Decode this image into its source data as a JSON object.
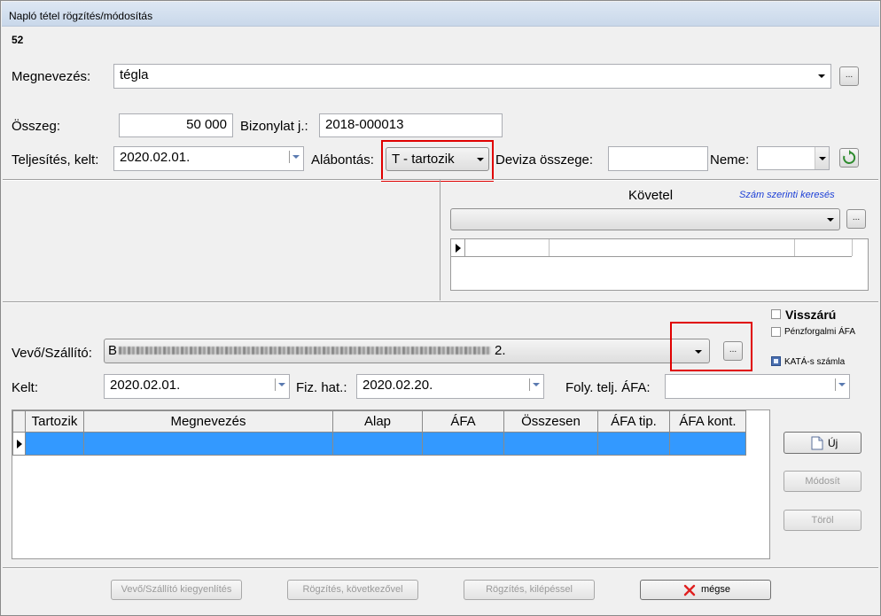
{
  "window": {
    "title": "Napló tétel rögzítés/módosítás"
  },
  "record_id": "52",
  "megnevezes": {
    "label": "Megnevezés:",
    "value": "tégla"
  },
  "osszeg": {
    "label": "Összeg:",
    "value": "50 000"
  },
  "bizonylat": {
    "label": "Bizonylat j.:",
    "value": "2018-000013"
  },
  "teljesites": {
    "label": "Teljesítés, kelt:",
    "value": "2020.02.01."
  },
  "alabontas": {
    "label": "Alábontás:",
    "value": "T - tartozik"
  },
  "deviza": {
    "label": "Deviza összege:",
    "value": ""
  },
  "neme": {
    "label": "Neme:",
    "value": ""
  },
  "kovetel": {
    "label": "Követel",
    "search_link": "Szám szerinti keresés",
    "value": ""
  },
  "vevo": {
    "visszaru_label": "Visszárú",
    "penzforgalmi_label": "Pénzforgalmi ÁFA",
    "kata_label": "KATÁ-s számla",
    "kata_checked": true,
    "label": "Vevő/Szállító:",
    "value_start": "B",
    "value_end": "2."
  },
  "kelt": {
    "label": "Kelt:",
    "value": "2020.02.01."
  },
  "fizhat": {
    "label": "Fiz. hat.:",
    "value": "2020.02.20."
  },
  "folyafa": {
    "label": "Foly. telj. ÁFA:",
    "value": ""
  },
  "table": {
    "columns": [
      "Tartozik",
      "Megnevezés",
      "Alap",
      "ÁFA",
      "Összesen",
      "ÁFA tip.",
      "ÁFA kont."
    ]
  },
  "side_buttons": {
    "uj": "Új",
    "modosit": "Módosít",
    "torol": "Töröl"
  },
  "bottom_buttons": {
    "kiegyenlites": "Vevő/Szállító kiegyenlítés",
    "kovetkezovel": "Rögzítés, következővel",
    "kilepessel": "Rögzítés, kilépéssel",
    "megse": "mégse"
  },
  "dots": "...",
  "colors": {
    "selection": "#3399ff",
    "highlight_box": "#e00000"
  }
}
